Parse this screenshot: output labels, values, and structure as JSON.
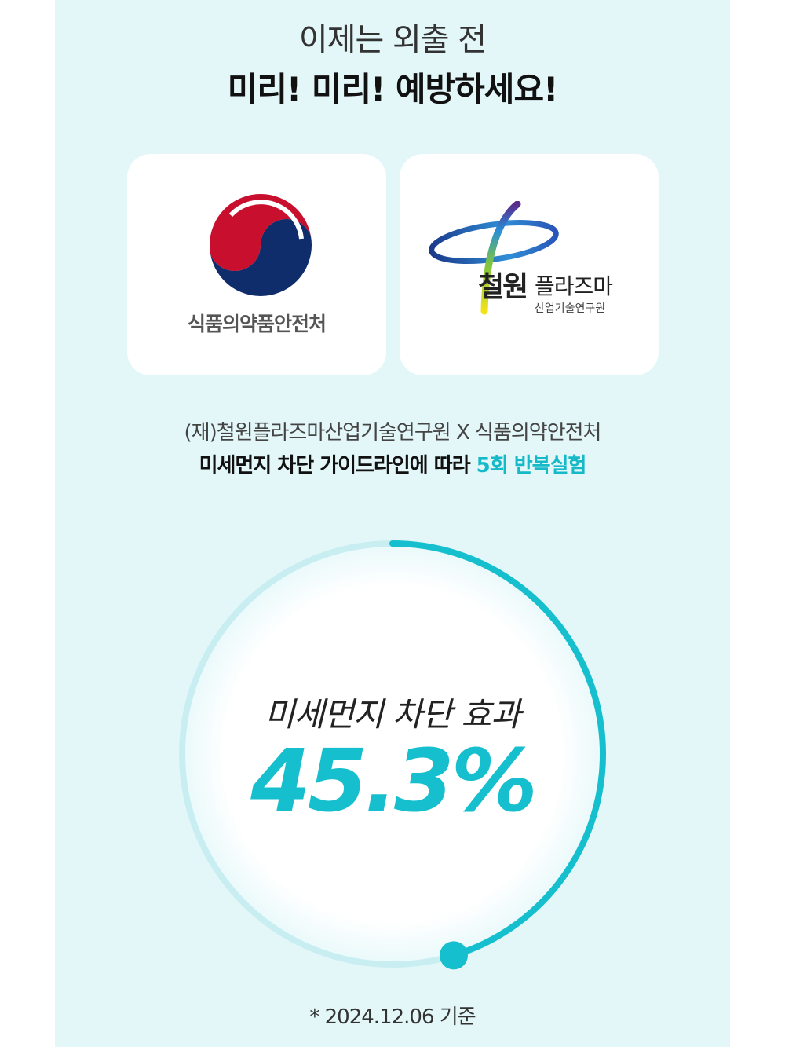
{
  "header": {
    "line1": "이제는 외출 전",
    "line2": "미리! 미리! 예방하세요!"
  },
  "partners": {
    "mfds_name": "식품의약품안전처",
    "plasma_brand": "철원",
    "plasma_brand_right": "플라즈마",
    "plasma_brand_sub": "산업기술연구원"
  },
  "description": {
    "line1": "(재)철원플라즈마산업기술연구원 X 식품의약안전처",
    "line2_prefix": "미세먼지 차단 가이드라인에 따라 ",
    "line2_highlight": "5회 반복실험"
  },
  "result": {
    "label": "미세먼지 차단 효과",
    "value": "45.3%",
    "progress": 0.453
  },
  "footnote": "* 2024.12.06 기준",
  "colors": {
    "panel_bg": "#e3f7f9",
    "accent": "#16bfcd",
    "track": "#c8eef2"
  }
}
